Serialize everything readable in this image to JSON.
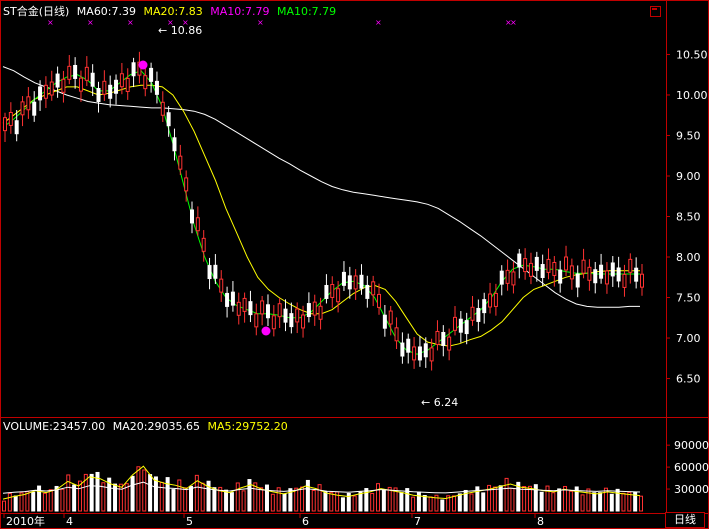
{
  "header": {
    "title": "ST合金(日线)",
    "ma60": "MA60:7.39",
    "ma20": "MA20:7.83",
    "ma10a": "MA10:7.79",
    "ma10b": "MA10:7.79"
  },
  "volume_header": {
    "volume": "VOLUME:23457.00",
    "ma20": "MA20:29035.65",
    "ma5": "MA5:29752.20"
  },
  "period_button": "日线",
  "annotations": {
    "high": "10.86",
    "low": "6.24"
  },
  "colors": {
    "up": "#ff3232",
    "down": "#ffffff",
    "ma_fast": "#ffff00",
    "ma_mid": "#00ff00",
    "ma_slow": "#ffffff",
    "frame": "#c00000",
    "marker": "#ff00ff"
  },
  "chart_data": [
    {
      "type": "candlestick",
      "title": "ST合金(日线)",
      "y_ticks": [
        "10.50",
        "10.00",
        "9.50",
        "9.00",
        "8.50",
        "8.00",
        "7.50",
        "7.00",
        "6.50"
      ],
      "ylim": [
        6.05,
        10.95
      ],
      "x_ticks": [
        "2010年",
        "4",
        "5",
        "6",
        "7",
        "8"
      ],
      "series": [
        {
          "name": "MA60",
          "values": [
            10.35,
            10.3,
            10.22,
            10.15,
            10.1,
            10.05,
            10.0,
            9.96,
            9.92,
            9.9,
            9.88,
            9.87,
            9.86,
            9.85,
            9.84,
            9.84,
            9.83,
            9.82,
            9.8,
            9.76,
            9.7,
            9.62,
            9.54,
            9.46,
            9.38,
            9.3,
            9.22,
            9.15,
            9.07,
            9.0,
            8.93,
            8.87,
            8.83,
            8.8,
            8.78,
            8.76,
            8.74,
            8.72,
            8.7,
            8.68,
            8.65,
            8.6,
            8.52,
            8.44,
            8.35,
            8.26,
            8.16,
            8.06,
            7.96,
            7.86,
            7.76,
            7.66,
            7.56,
            7.48,
            7.42,
            7.39,
            7.38,
            7.38,
            7.38,
            7.39,
            7.39
          ]
        },
        {
          "name": "MA20",
          "values": [
            9.65,
            9.75,
            9.85,
            9.95,
            10.0,
            10.05,
            10.1,
            10.1,
            10.05,
            10.0,
            10.02,
            10.06,
            10.1,
            10.12,
            10.12,
            10.1,
            10.0,
            9.8,
            9.55,
            9.25,
            8.95,
            8.6,
            8.3,
            8.0,
            7.75,
            7.6,
            7.5,
            7.42,
            7.35,
            7.3,
            7.3,
            7.35,
            7.45,
            7.55,
            7.62,
            7.65,
            7.6,
            7.45,
            7.25,
            7.05,
            6.95,
            6.92,
            6.9,
            6.93,
            6.98,
            7.02,
            7.1,
            7.2,
            7.35,
            7.5,
            7.6,
            7.65,
            7.7,
            7.75,
            7.78,
            7.8,
            7.82,
            7.83,
            7.83,
            7.83,
            7.83
          ]
        },
        {
          "name": "MA10",
          "values": [
            9.6,
            9.7,
            9.82,
            9.95,
            10.05,
            10.15,
            10.22,
            10.25,
            10.18,
            10.05,
            10.05,
            10.15,
            10.25,
            10.3,
            10.15,
            9.85,
            9.4,
            8.9,
            8.4,
            8.0,
            7.7,
            7.5,
            7.4,
            7.35,
            7.3,
            7.3,
            7.28,
            7.25,
            7.25,
            7.32,
            7.45,
            7.58,
            7.68,
            7.7,
            7.65,
            7.5,
            7.25,
            7.0,
            6.85,
            6.8,
            6.85,
            6.95,
            7.05,
            7.15,
            7.25,
            7.35,
            7.5,
            7.7,
            7.85,
            7.9,
            7.88,
            7.85,
            7.85,
            7.82,
            7.8,
            7.8,
            7.79,
            7.79,
            7.79,
            7.79,
            7.79
          ]
        },
        {
          "name": "VOLUME",
          "values": [
            18000,
            22000,
            25000,
            31000,
            28000,
            33000,
            45000,
            38000,
            52000,
            49000,
            41000,
            36000,
            55000,
            68000,
            47000,
            42000,
            39000,
            34000,
            46000,
            37000,
            31000,
            28000,
            35000,
            40000,
            33000,
            29000,
            26000,
            30000,
            38000,
            34000,
            27000,
            24000,
            22000,
            26000,
            29000,
            34000,
            31000,
            28000,
            24000,
            22000,
            20000,
            19000,
            23000,
            27000,
            30000,
            33000,
            37000,
            41000,
            36000,
            34000,
            31000,
            29000,
            33000,
            30000,
            28000,
            26000,
            29000,
            27000,
            25000,
            23457
          ]
        }
      ],
      "volume_ticks": [
        "90000",
        "60000",
        "30000"
      ],
      "volume_ylim": [
        0,
        108000
      ]
    }
  ]
}
